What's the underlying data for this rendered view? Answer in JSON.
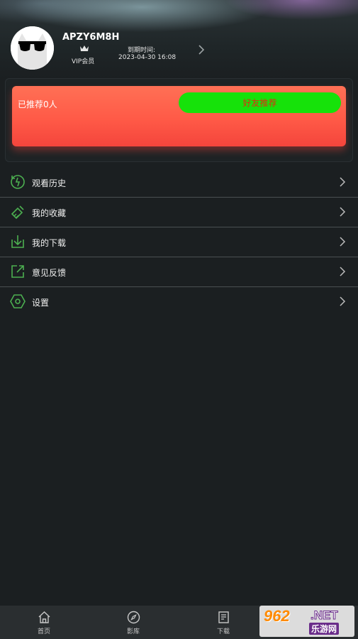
{
  "profile": {
    "username": "APZY6M8H",
    "membership": "VIP会员",
    "expire_label": "到期时间:",
    "expire_time": "2023-04-30 16:08"
  },
  "referral": {
    "count_text": "已推荐0人",
    "invite_button": "好友推荐"
  },
  "menu": {
    "items": [
      {
        "label": "观看历史",
        "icon": "history-icon"
      },
      {
        "label": "我的收藏",
        "icon": "favorites-icon"
      },
      {
        "label": "我的下载",
        "icon": "download-icon"
      },
      {
        "label": "意见反馈",
        "icon": "feedback-icon"
      },
      {
        "label": "设置",
        "icon": "settings-icon"
      }
    ]
  },
  "tabbar": {
    "tabs": [
      {
        "label": "首页",
        "icon": "home-icon"
      },
      {
        "label": "影库",
        "icon": "compass-icon"
      },
      {
        "label": "下载",
        "icon": "download-list-icon"
      }
    ]
  },
  "watermark": {
    "logo": "962",
    "suffix": ".NET",
    "sub": "乐游网"
  },
  "colors": {
    "background": "#1b1f21",
    "accent_green": "#16e20a",
    "card_red": "#ff5a47",
    "icon_green": "#4caf50"
  }
}
